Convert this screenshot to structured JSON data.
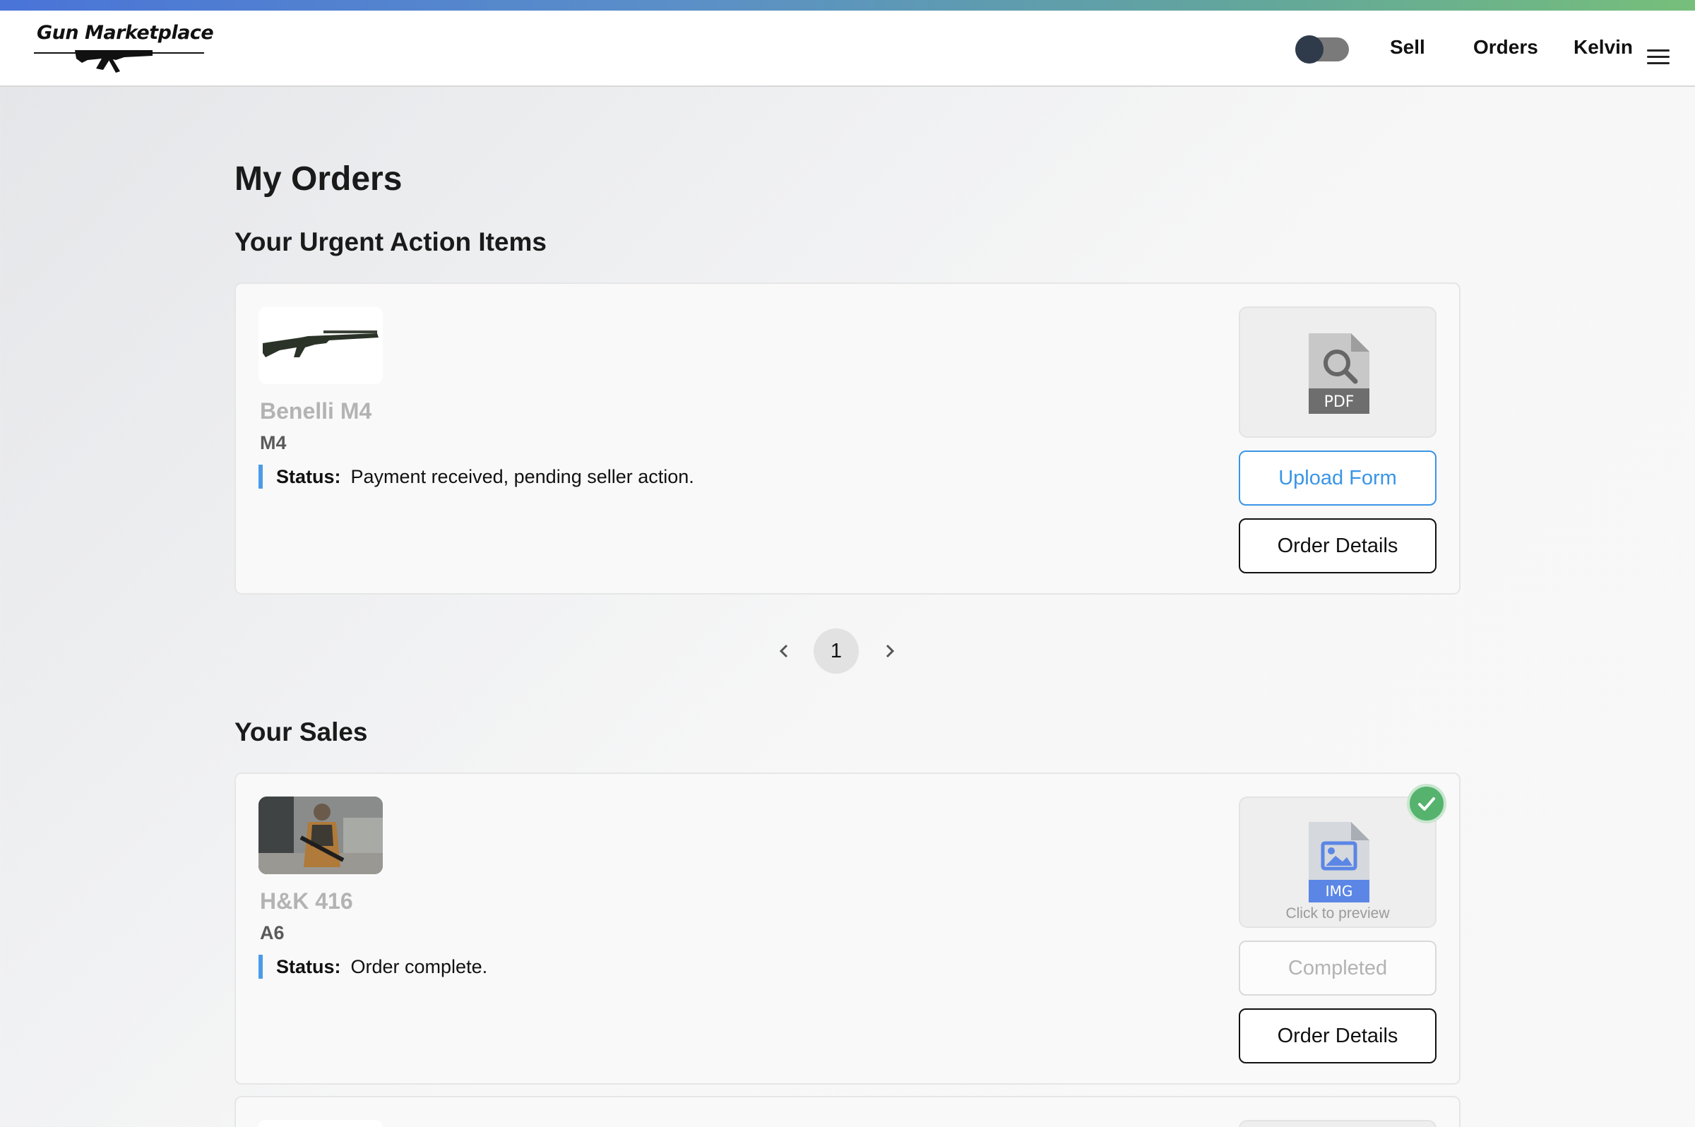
{
  "header": {
    "logo_text": "Gun Marketplace",
    "theme_toggle": "dark-mode-toggle",
    "nav": {
      "sell": "Sell",
      "orders": "Orders",
      "user": "Kelvin"
    }
  },
  "page": {
    "title": "My Orders"
  },
  "urgent": {
    "title": "Your Urgent Action Items",
    "items": [
      {
        "name": "Benelli M4",
        "model": "M4",
        "status_label": "Status:",
        "status": "Payment received, pending seller action.",
        "doc_type": "PDF",
        "upload_label": "Upload Form",
        "details_label": "Order Details"
      }
    ],
    "pagination": {
      "current": "1"
    }
  },
  "sales": {
    "title": "Your Sales",
    "items": [
      {
        "name": "H&K 416",
        "model": "A6",
        "status_label": "Status:",
        "status": "Order complete.",
        "doc_type": "IMG",
        "preview_label": "Click to preview",
        "completed_label": "Completed",
        "details_label": "Order Details"
      }
    ]
  },
  "colors": {
    "accent_blue": "#3a95e6",
    "status_bar": "#4c9be8",
    "success_green": "#55b36d",
    "header_gradient": [
      "#4a74d8",
      "#76bf7a"
    ]
  }
}
